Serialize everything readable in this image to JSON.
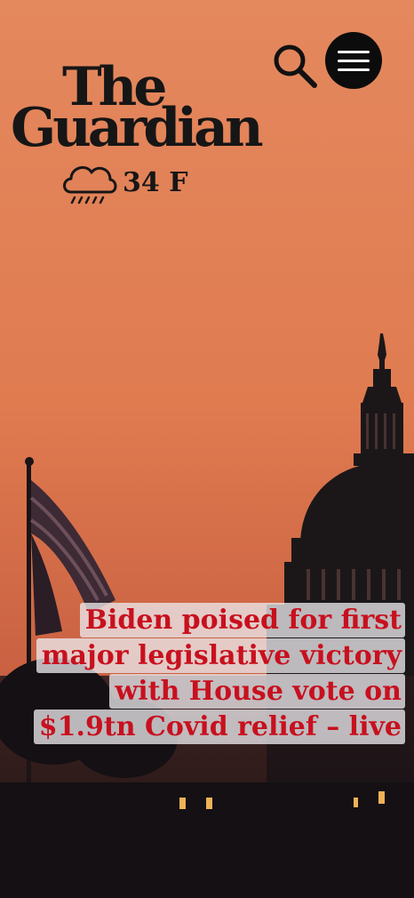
{
  "header": {
    "logo_line1": "The",
    "logo_line2": "Guardian"
  },
  "weather": {
    "icon": "rain-cloud-icon",
    "temperature": "34 F"
  },
  "controls": {
    "search_icon": "search-icon",
    "menu_icon": "hamburger-menu-icon"
  },
  "hero": {
    "image": "capitol-dome-sunset-photo",
    "headline": "Biden poised for first major legislative victory with House vote on $1.9tn Covid relief – live"
  },
  "colors": {
    "sky_top": "#e4875d",
    "sky_bottom": "#c65a3e",
    "headline_text": "#c8101e",
    "logo": "#161616"
  }
}
